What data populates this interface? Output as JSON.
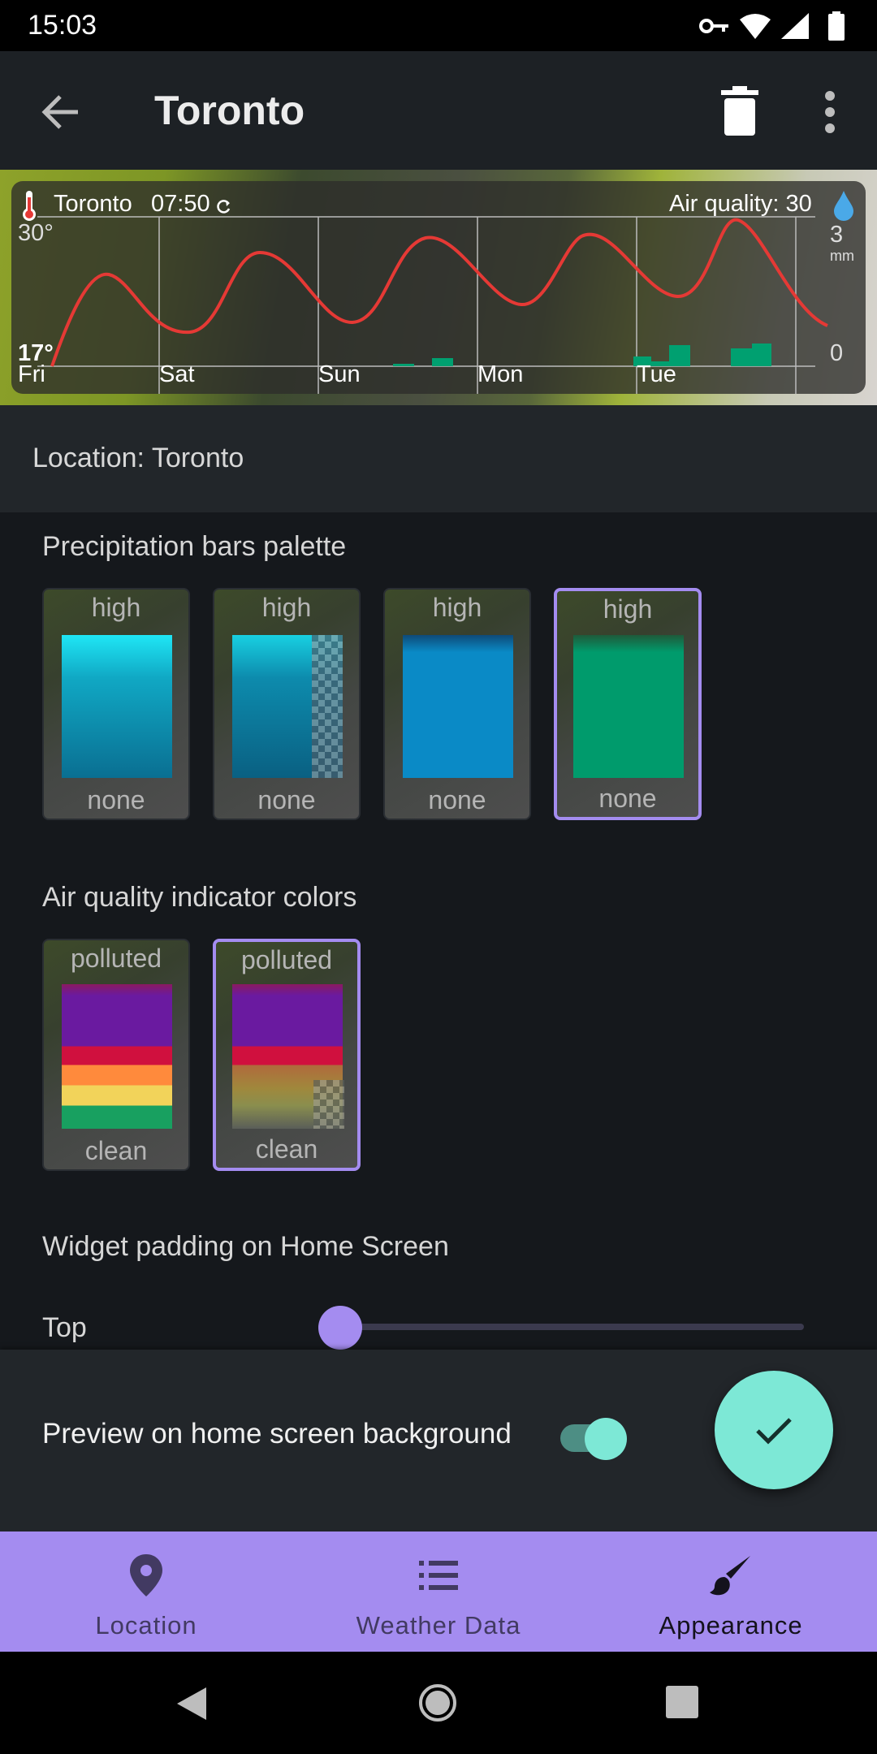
{
  "status_bar": {
    "time": "15:03"
  },
  "app_bar": {
    "title": "Toronto"
  },
  "widget": {
    "location": "Toronto",
    "time": "07:50",
    "air_quality_label": "Air quality: 30",
    "temp_max": "30°",
    "temp_min": "17°",
    "precip_max": "3",
    "precip_unit": "mm",
    "precip_min": "0",
    "days": [
      "Fri",
      "Sat",
      "Sun",
      "Mon",
      "Tue"
    ]
  },
  "location_row": {
    "text": "Location: Toronto"
  },
  "precipitation": {
    "title": "Precipitation bars palette",
    "swatches": [
      {
        "top": "high",
        "bottom": "none",
        "selected": false
      },
      {
        "top": "high",
        "bottom": "none",
        "selected": false
      },
      {
        "top": "high",
        "bottom": "none",
        "selected": false
      },
      {
        "top": "high",
        "bottom": "none",
        "selected": true
      }
    ]
  },
  "air_quality": {
    "title": "Air quality indicator colors",
    "swatches": [
      {
        "top": "polluted",
        "bottom": "clean",
        "selected": false
      },
      {
        "top": "polluted",
        "bottom": "clean",
        "selected": true
      }
    ]
  },
  "padding": {
    "title": "Widget padding on Home Screen",
    "top_label": "Top",
    "top_value": 0
  },
  "preview_toggle": {
    "label": "Preview on home screen background",
    "on": true
  },
  "bottom_nav": {
    "items": [
      {
        "label": "Location",
        "icon": "location-pin-icon",
        "active": false
      },
      {
        "label": "Weather Data",
        "icon": "list-icon",
        "active": false
      },
      {
        "label": "Appearance",
        "icon": "brush-icon",
        "active": true
      }
    ]
  },
  "colors": {
    "accent": "#a48cf0",
    "teal": "#7de8d6",
    "temp_line": "#e53935",
    "precip_bar": "#00a070"
  }
}
